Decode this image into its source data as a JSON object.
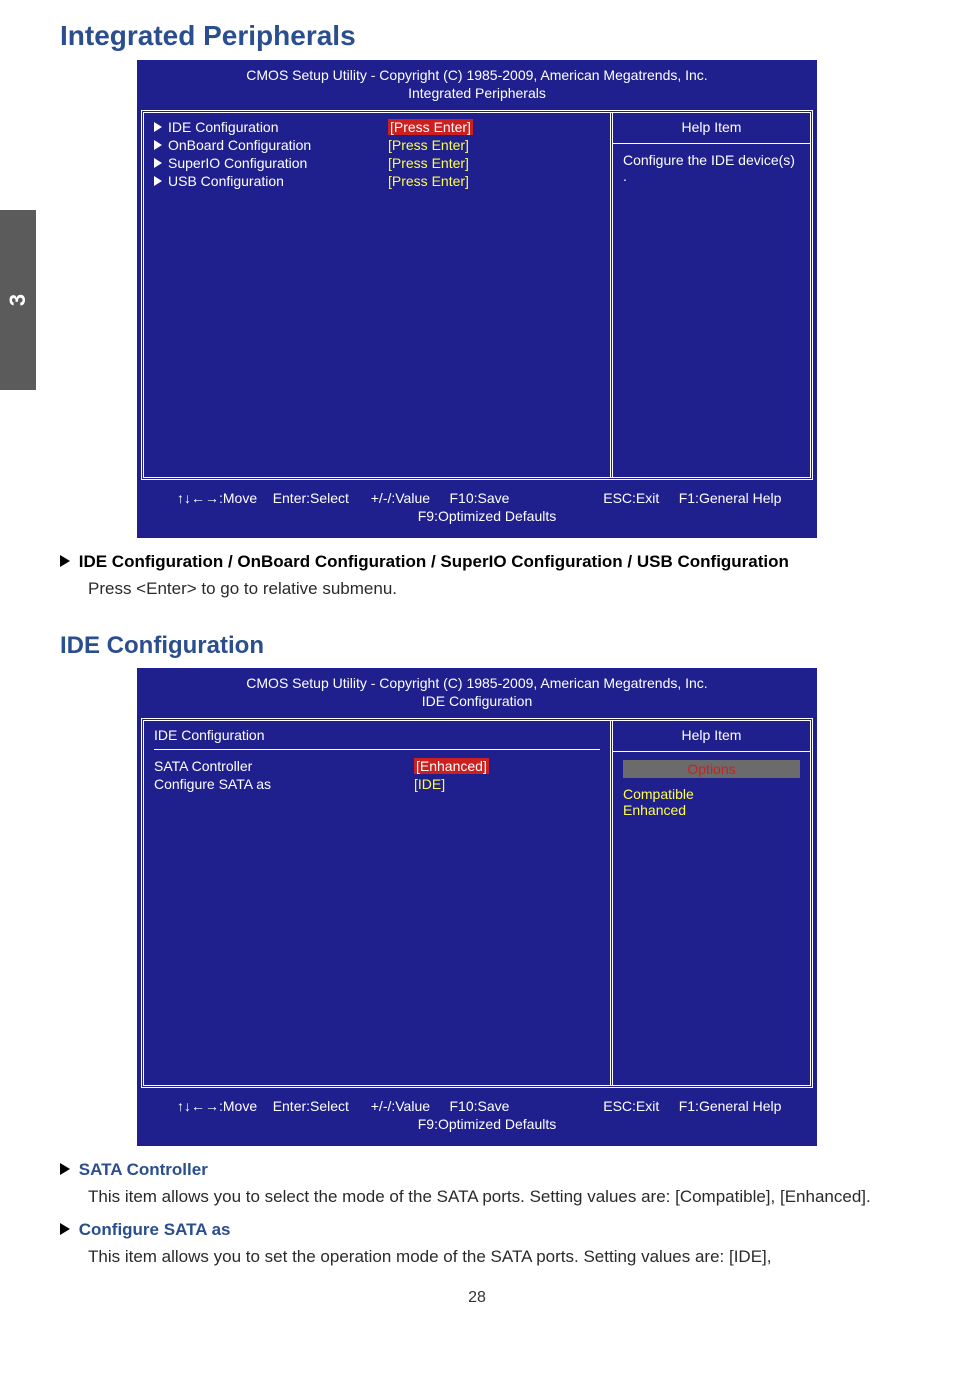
{
  "page_tab": "3",
  "page_number": "28",
  "section1": {
    "title": "Integrated Peripherals",
    "bios": {
      "header_line1": "CMOS Setup Utility - Copyright (C) 1985-2009, American Megatrends, Inc.",
      "header_line2": "Integrated Peripherals",
      "items": [
        {
          "label": "IDE Configuration",
          "value": "[Press Enter]",
          "highlight": true
        },
        {
          "label": "OnBoard Configuration",
          "value": "[Press Enter]",
          "highlight": false
        },
        {
          "label": "SuperIO Configuration",
          "value": "[Press Enter]",
          "highlight": false
        },
        {
          "label": "USB Configuration",
          "value": "[Press Enter]",
          "highlight": false
        }
      ],
      "help_title": "Help Item",
      "help_text": "Configure the IDE device(s) .",
      "footer": {
        "move": "↑↓←→:Move",
        "select": "Enter:Select",
        "value": "+/-/:Value",
        "save": "F10:Save",
        "exit": "ESC:Exit",
        "general": "F1:General Help",
        "defaults": "F9:Optimized Defaults"
      }
    },
    "desc_header_bold1": "IDE Configuration / ",
    "desc_header_bold2": "OnBoard Configuration / SuperIO Configuration / USB Configuration",
    "desc_text": "Press <Enter> to go to relative submenu."
  },
  "section2": {
    "title": "IDE Configuration",
    "bios": {
      "header_line1": "CMOS Setup Utility - Copyright (C) 1985-2009, American Megatrends, Inc.",
      "header_line2": "IDE Configuration",
      "group_label": "IDE Configuration",
      "items": [
        {
          "label": "SATA Controller",
          "value": "[Enhanced]",
          "highlight": true
        },
        {
          "label": "Configure SATA as",
          "value": "[IDE]",
          "highlight": false
        }
      ],
      "help_title": "Help Item",
      "options_label": "Options",
      "options": [
        "Compatible",
        "Enhanced"
      ],
      "footer": {
        "move": "↑↓←→:Move",
        "select": "Enter:Select",
        "value": "+/-/:Value",
        "save": "F10:Save",
        "exit": "ESC:Exit",
        "general": "F1:General Help",
        "defaults": "F9:Optimized Defaults"
      }
    },
    "item1": {
      "title": "SATA Controller",
      "text": "This item allows you to select the mode of the SATA ports. Setting values are: [Compatible], [Enhanced]."
    },
    "item2": {
      "title": "Configure SATA as",
      "text": "This item allows you to set the operation mode of the SATA ports. Setting values are: [IDE],"
    }
  }
}
